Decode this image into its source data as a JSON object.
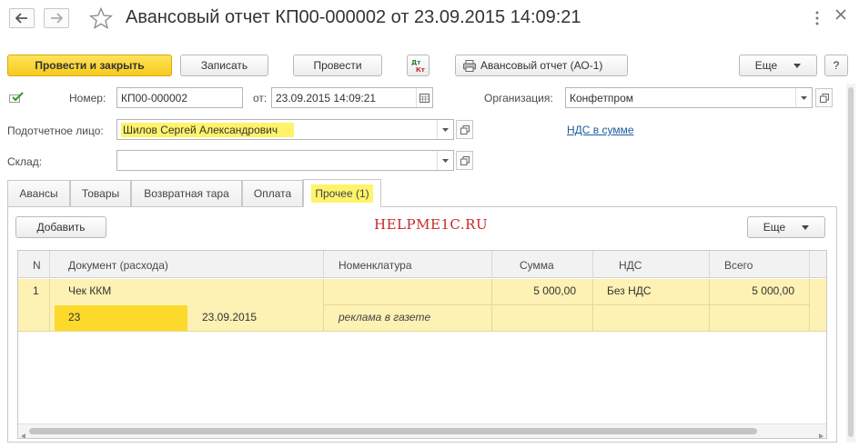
{
  "window": {
    "title": "Авансовый отчет КП00-000002 от 23.09.2015 14:09:21"
  },
  "toolbar": {
    "post_close": "Провести и закрыть",
    "save": "Записать",
    "post": "Провести",
    "print_report": "Авансовый отчет (АО-1)",
    "more": "Еще",
    "help": "?"
  },
  "form": {
    "number_label": "Номер:",
    "number_value": "КП00-000002",
    "date_label": "от:",
    "date_value": "23.09.2015 14:09:21",
    "org_label": "Организация:",
    "org_value": "Конфетпром",
    "person_label": "Подотчетное лицо:",
    "person_value": "Шилов Сергей Александрович",
    "vat_link": "НДС в сумме",
    "warehouse_label": "Склад:",
    "warehouse_value": ""
  },
  "tabs": [
    {
      "label": "Авансы"
    },
    {
      "label": "Товары"
    },
    {
      "label": "Возвратная тара"
    },
    {
      "label": "Оплата"
    },
    {
      "label": "Прочее (1)"
    }
  ],
  "panel": {
    "add": "Добавить",
    "watermark": "HELPME1C.RU",
    "more": "Еще"
  },
  "table": {
    "columns": [
      "N",
      "Документ (расхода)",
      "Номенклатура",
      "Сумма",
      "НДС",
      "Всего"
    ],
    "rows": [
      {
        "n": "1",
        "doc": "Чек ККМ",
        "doc_number": "23",
        "doc_date": "23.09.2015",
        "nomenclature": "",
        "nomenclature_note": "реклама в газете",
        "sum": "5 000,00",
        "vat": "Без НДС",
        "total": "5 000,00"
      }
    ]
  },
  "colors": {
    "accent_yellow": "#f7c91d",
    "row_highlight": "#fdf1b4",
    "link_blue": "#1a5b9e",
    "watermark_red": "#c62828"
  }
}
